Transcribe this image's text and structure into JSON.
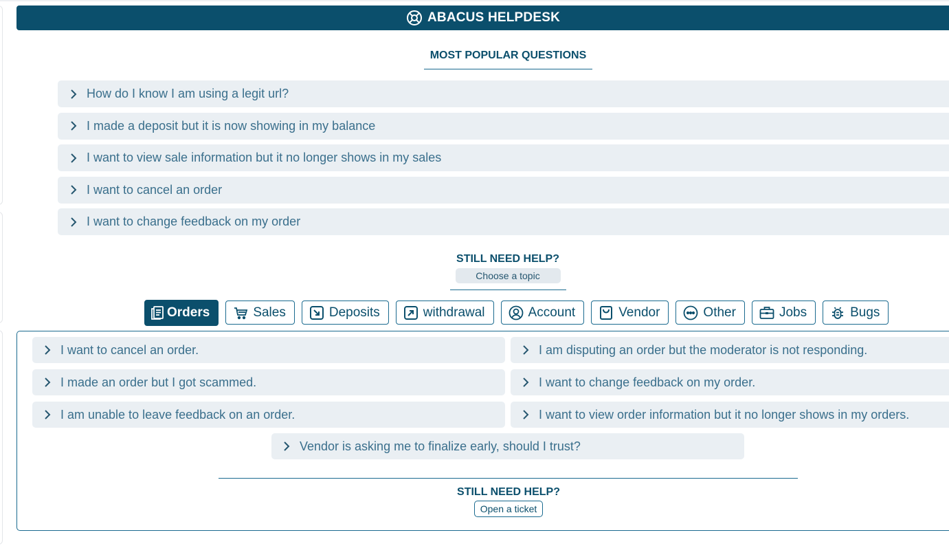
{
  "header": {
    "title": "ABACUS HELPDESK",
    "logo_icon": "lifebuoy-icon"
  },
  "popular": {
    "title": "MOST POPULAR QUESTIONS",
    "items": [
      "How do I know I am using a legit url?",
      "I made a deposit but it is now showing in my balance",
      "I want to view sale information but it no longer shows in my sales",
      "I want to cancel an order",
      "I want to change feedback on my order"
    ]
  },
  "help_section": {
    "title": "STILL NEED HELP?",
    "choose_topic_label": "Choose a topic"
  },
  "topics": [
    {
      "label": "Orders",
      "icon": "document-icon",
      "active": true
    },
    {
      "label": "Sales",
      "icon": "cart-icon",
      "active": false
    },
    {
      "label": "Deposits",
      "icon": "arrow-down-right-icon",
      "active": false
    },
    {
      "label": "withdrawal",
      "icon": "arrow-up-right-icon",
      "active": false
    },
    {
      "label": "Account",
      "icon": "user-circle-icon",
      "active": false
    },
    {
      "label": "Vendor",
      "icon": "shopping-bag-icon",
      "active": false
    },
    {
      "label": "Other",
      "icon": "more-circle-icon",
      "active": false
    },
    {
      "label": "Jobs",
      "icon": "briefcase-icon",
      "active": false
    },
    {
      "label": "Bugs",
      "icon": "bug-icon",
      "active": false
    }
  ],
  "orders_questions": [
    "I want to cancel an order.",
    "I am disputing an order but the moderator is not responding.",
    "I made an order but I got scammed.",
    "I want to change feedback on my order.",
    "I am unable to leave feedback on an order.",
    "I want to view order information but it no longer shows in my orders.",
    "Vendor is asking me to finalize early, should I trust?"
  ],
  "ticket_section": {
    "title": "STILL NEED HELP?",
    "open_ticket_label": "Open a ticket"
  },
  "colors": {
    "primary": "#0b4f6c",
    "item_bg": "#eaeff3",
    "item_text": "#3a6f8c",
    "border": "#1a6a8f"
  }
}
